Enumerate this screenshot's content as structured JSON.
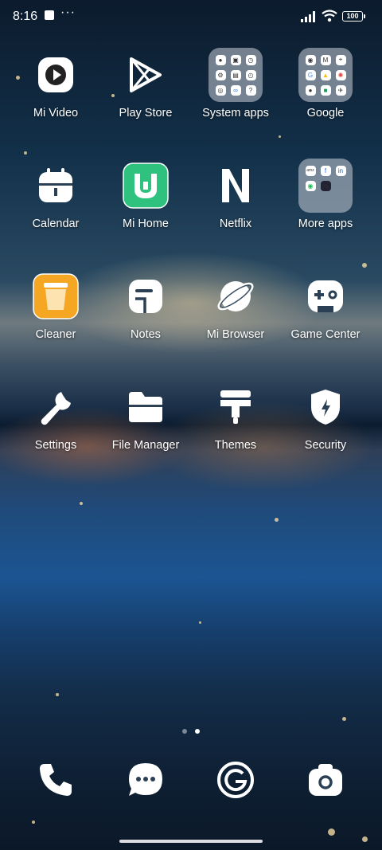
{
  "status_bar": {
    "time": "8:16",
    "battery": "100"
  },
  "apps": [
    {
      "label": "Mi Video"
    },
    {
      "label": "Play Store"
    },
    {
      "label": "System apps"
    },
    {
      "label": "Google"
    },
    {
      "label": "Calendar"
    },
    {
      "label": "Mi Home"
    },
    {
      "label": "Netflix"
    },
    {
      "label": "More apps"
    },
    {
      "label": "Cleaner"
    },
    {
      "label": "Notes"
    },
    {
      "label": "Mi Browser"
    },
    {
      "label": "Game Center"
    },
    {
      "label": "Settings"
    },
    {
      "label": "File Manager"
    },
    {
      "label": "Themes"
    },
    {
      "label": "Security"
    }
  ],
  "dock": [
    {
      "icon": "phone-icon"
    },
    {
      "icon": "messages-icon"
    },
    {
      "icon": "browser-g-icon"
    },
    {
      "icon": "camera-icon"
    }
  ],
  "page_indicator": {
    "pages": 2,
    "current": 2
  },
  "colors": {
    "mi_home": "#2ec27e",
    "cleaner": "#f5a623",
    "folder": "rgba(200,205,215,0.55)"
  }
}
